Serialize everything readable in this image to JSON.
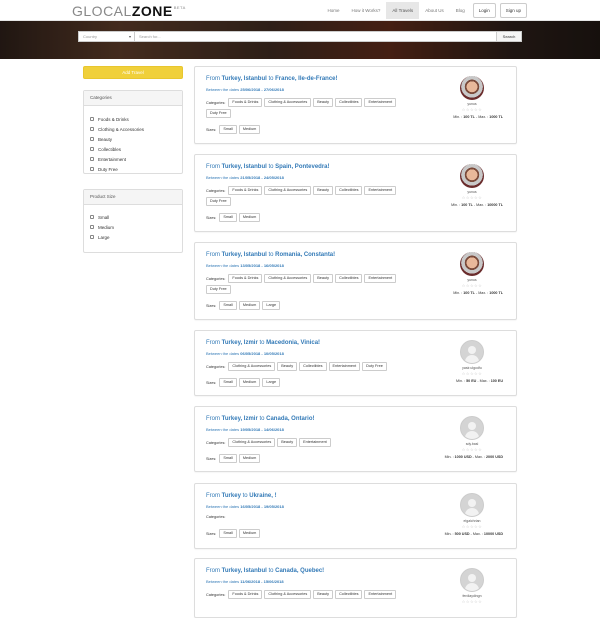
{
  "header": {
    "logo_part1": "GLOCAL",
    "logo_part2": "ZONE",
    "logo_badge": "BETA",
    "nav": [
      {
        "label": "Home",
        "active": false
      },
      {
        "label": "How it Works?",
        "active": false
      },
      {
        "label": "All Travels",
        "active": true
      },
      {
        "label": "About Us",
        "active": false
      },
      {
        "label": "Blog",
        "active": false
      }
    ],
    "login_label": "Login",
    "signup_label": "Sign up"
  },
  "search": {
    "country_placeholder": "Country",
    "search_placeholder": "Search for...",
    "button_label": "Search"
  },
  "sidebar": {
    "add_travel_label": "Add Travel",
    "categories_title": "Categories",
    "categories": [
      "Foods & Drinks",
      "Clothing & Accessories",
      "Beauty",
      "Collectibles",
      "Entertainment",
      "Duty Free"
    ],
    "size_title": "Product Size",
    "sizes": [
      "Small",
      "Medium",
      "Large"
    ]
  },
  "labels": {
    "from": "From",
    "to": "to",
    "between": "Between the dates",
    "categories": "Categories:",
    "sizes": "Sizes:",
    "min": "Min. :",
    "max": "Max. :",
    "stars": "☆☆☆☆☆"
  },
  "travels": [
    {
      "from_country": "Turkey",
      "from_city": "Istanbul",
      "to_country": "France",
      "to_city": "Ile-de-France",
      "dates": "25/06/2018 - 27/06/2018",
      "categories": [
        "Foods & Drinks",
        "Clothing & Accessories",
        "Beauty",
        "Collectibles",
        "Entertainment",
        "Duty Free"
      ],
      "sizes": [
        "Small",
        "Medium"
      ],
      "user": "yunus",
      "avatar": "photo",
      "min": "100 TL",
      "max": "1000 TL"
    },
    {
      "from_country": "Turkey",
      "from_city": "Istanbul",
      "to_country": "Spain",
      "to_city": "Pontevedra",
      "dates": "21/05/2018 - 24/05/2018",
      "categories": [
        "Foods & Drinks",
        "Clothing & Accessories",
        "Beauty",
        "Collectibles",
        "Entertainment",
        "Duty Free"
      ],
      "sizes": [
        "Small",
        "Medium"
      ],
      "user": "yunus",
      "avatar": "photo",
      "min": "100 TL",
      "max": "10000 TL"
    },
    {
      "from_country": "Turkey",
      "from_city": "Istanbul",
      "to_country": "Romania",
      "to_city": "Constanta",
      "dates": "13/05/2018 - 16/05/2018",
      "categories": [
        "Foods & Drinks",
        "Clothing & Accessories",
        "Beauty",
        "Collectibles",
        "Entertainment",
        "Duty Free"
      ],
      "sizes": [
        "Small",
        "Medium",
        "Large"
      ],
      "user": "yunus",
      "avatar": "photo",
      "min": "100 TL",
      "max": "1000 TL"
    },
    {
      "from_country": "Turkey",
      "from_city": "Izmir",
      "to_country": "Macedonia",
      "to_city": "Vinica",
      "dates": "06/05/2018 - 10/05/2018",
      "categories": [
        "Clothing & Accessories",
        "Beauty",
        "Collectibles",
        "Entertainment",
        "Duty Free"
      ],
      "sizes": [
        "Small",
        "Medium",
        "Large"
      ],
      "user": "yasir.ulgodfu",
      "avatar": "blank",
      "min": "50 EU",
      "max": "100 EU"
    },
    {
      "from_country": "Turkey",
      "from_city": "Izmir",
      "to_country": "Canada",
      "to_city": "Ontario",
      "dates": "19/05/2018 - 14/06/2018",
      "categories": [
        "Clothing & Accessories",
        "Beauty",
        "Entertainment"
      ],
      "sizes": [
        "Small",
        "Medium"
      ],
      "user": "sdy.basl",
      "avatar": "blank",
      "min": "1000 USD",
      "max": "2000 USD"
    },
    {
      "from_country": "Turkey",
      "from_city": "",
      "to_country": "Ukraine",
      "to_city": "",
      "dates": "16/05/2018 - 19/05/2018",
      "categories": [],
      "sizes": [
        "Small",
        "Medium"
      ],
      "user": "elgaichrian",
      "avatar": "blank",
      "min": "500 USD",
      "max": "10000 USD"
    },
    {
      "from_country": "Turkey",
      "from_city": "Istanbul",
      "to_country": "Canada",
      "to_city": "Quebec",
      "dates": "11/06/2018 - 15/06/2018",
      "categories": [
        "Foods & Drinks",
        "Clothing & Accessories",
        "Beauty",
        "Collectibles",
        "Entertainment"
      ],
      "sizes": [],
      "user": "ferdiaydingn",
      "avatar": "blank",
      "min": "",
      "max": ""
    }
  ]
}
